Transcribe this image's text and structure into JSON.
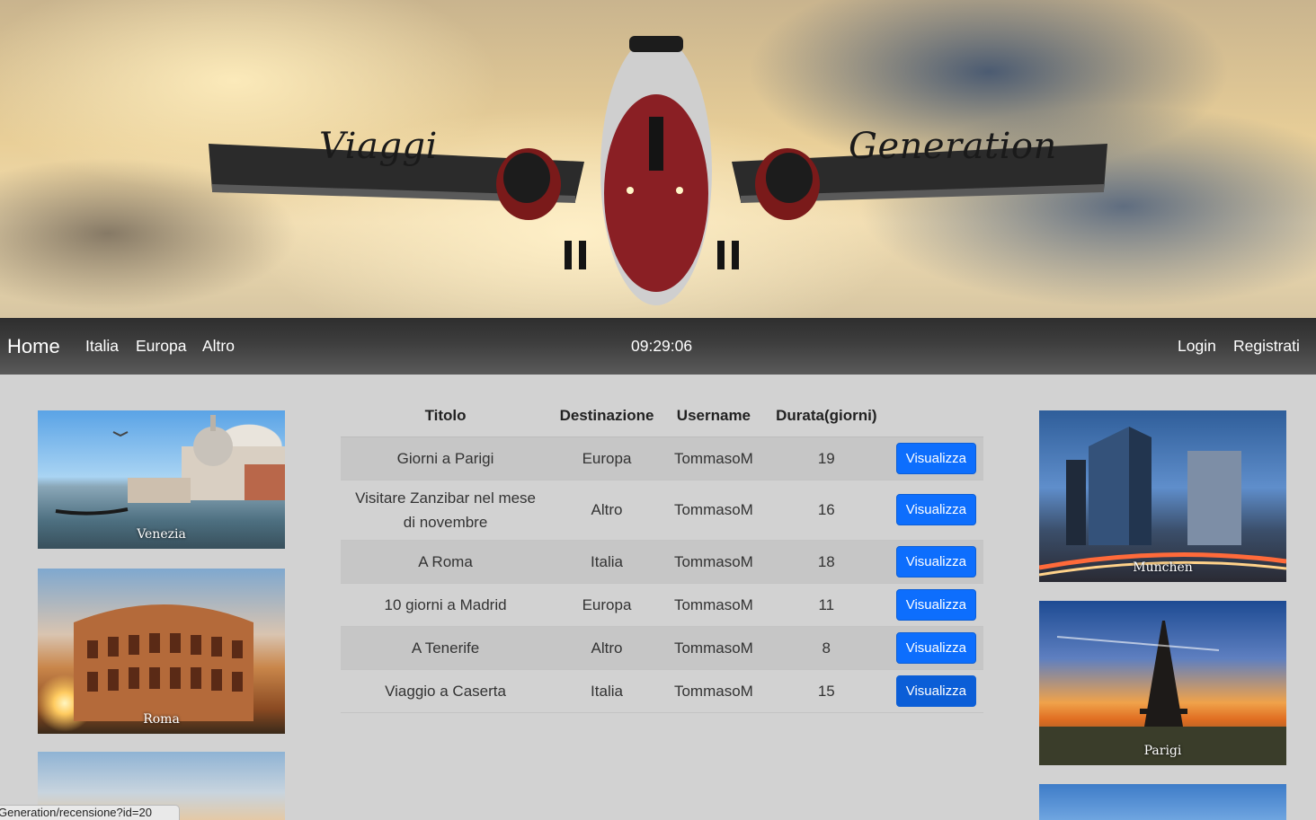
{
  "hero": {
    "word_left": "Viaggi",
    "word_right": "Generation"
  },
  "navbar": {
    "brand": "Home",
    "links": [
      "Italia",
      "Europa",
      "Altro"
    ],
    "clock": "09:29:06",
    "login": "Login",
    "register": "Registrati"
  },
  "left_cards": [
    {
      "caption": "Venezia"
    },
    {
      "caption": "Roma"
    },
    {
      "caption": ""
    }
  ],
  "right_cards": [
    {
      "caption": "Munchen"
    },
    {
      "caption": "Parigi"
    },
    {
      "caption": ""
    }
  ],
  "table": {
    "headers": [
      "Titolo",
      "Destinazione",
      "Username",
      "Durata(giorni)",
      ""
    ],
    "rows": [
      {
        "titolo": "Giorni a Parigi",
        "destinazione": "Europa",
        "username": "TommasoM",
        "durata": "19",
        "action": "Visualizza"
      },
      {
        "titolo": "Visitare Zanzibar nel mese di novembre",
        "destinazione": "Altro",
        "username": "TommasoM",
        "durata": "16",
        "action": "Visualizza"
      },
      {
        "titolo": "A Roma",
        "destinazione": "Italia",
        "username": "TommasoM",
        "durata": "18",
        "action": "Visualizza"
      },
      {
        "titolo": "10 giorni a Madrid",
        "destinazione": "Europa",
        "username": "TommasoM",
        "durata": "11",
        "action": "Visualizza"
      },
      {
        "titolo": "A Tenerife",
        "destinazione": "Altro",
        "username": "TommasoM",
        "durata": "8",
        "action": "Visualizza"
      },
      {
        "titolo": "Viaggio a Caserta",
        "destinazione": "Italia",
        "username": "TommasoM",
        "durata": "15",
        "action": "Visualizza"
      }
    ]
  },
  "statusbar": {
    "url": "Generation/recensione?id=20"
  },
  "colors": {
    "button_primary": "#0d6efd",
    "navbar": "#3e3e3e",
    "page_bg": "#d2d2d2"
  }
}
